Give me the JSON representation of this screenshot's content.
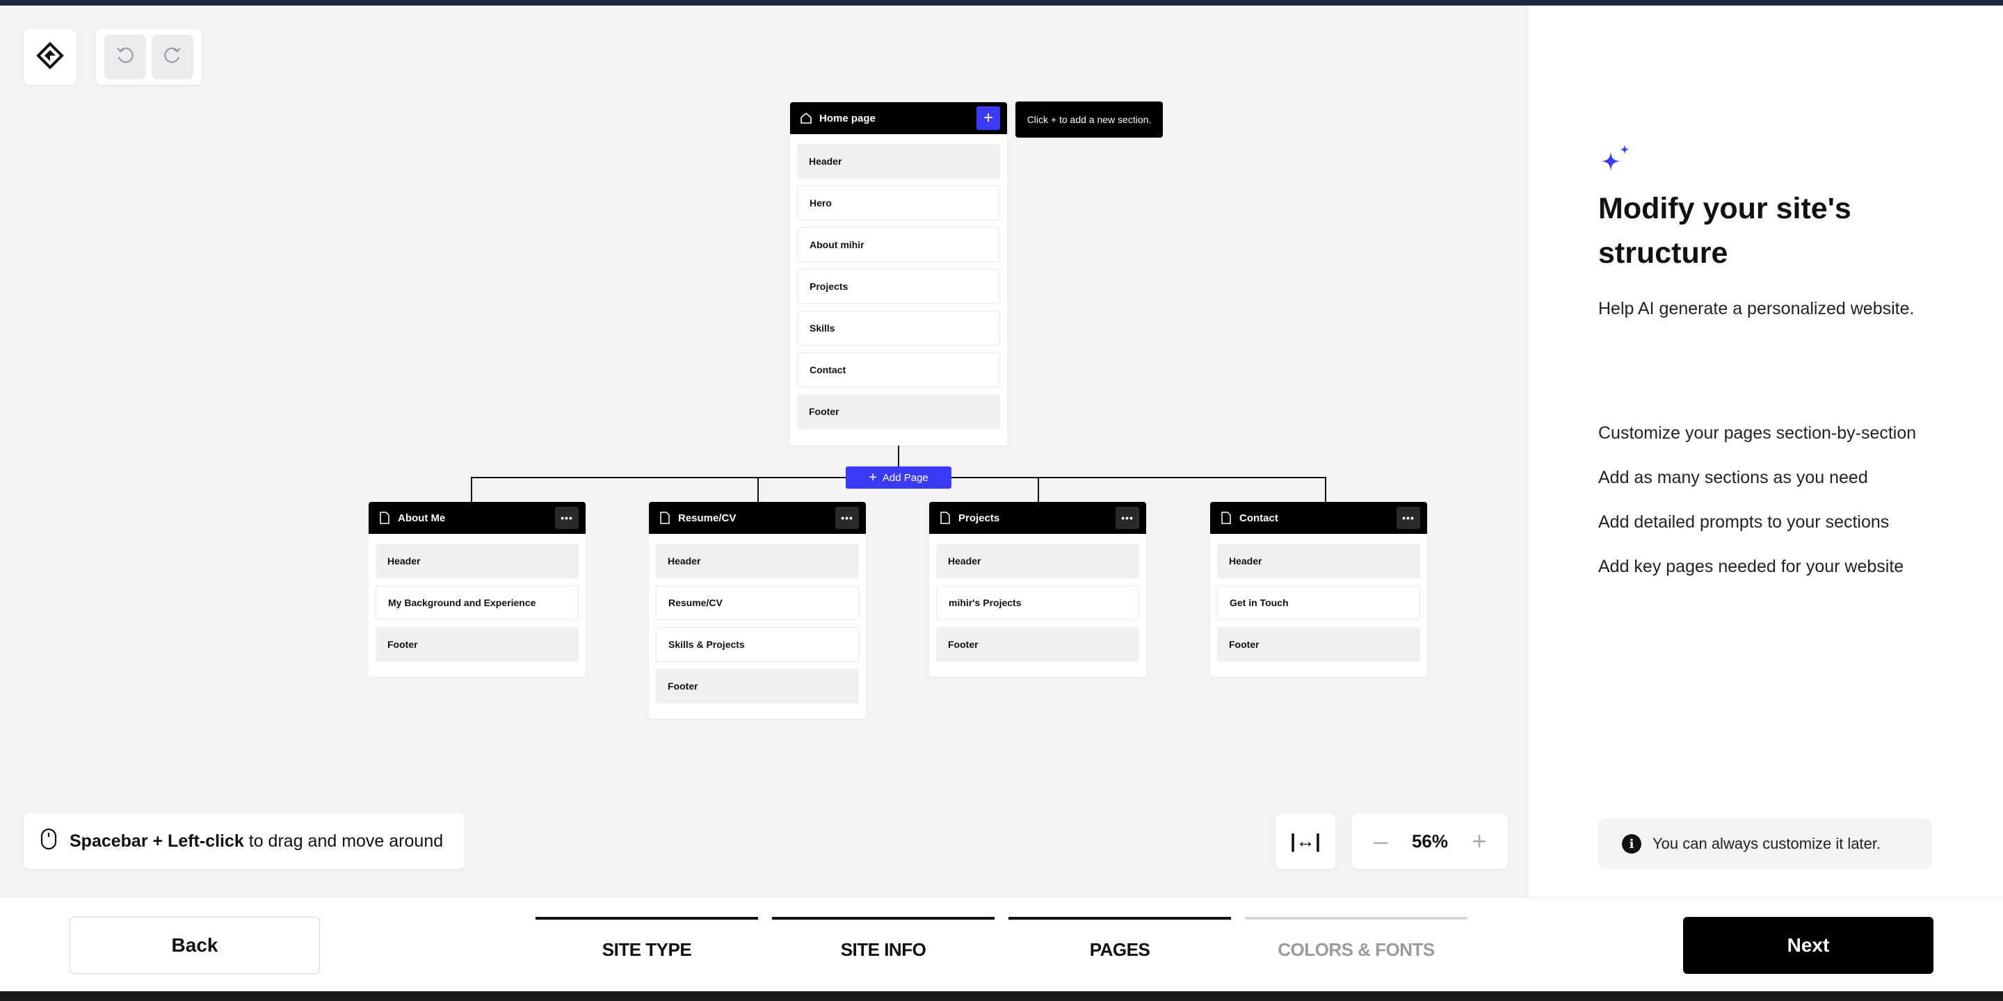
{
  "colors": {
    "accent": "#3b3bf5",
    "dark": "#000000",
    "canvas": "#f3f3f5"
  },
  "toolbar": {
    "logo_icon": "brand-logo-icon",
    "undo_icon": "undo-icon",
    "redo_icon": "redo-icon"
  },
  "tooltip": "Click + to add a new section.",
  "home": {
    "title": "Home page",
    "sections": [
      "Header",
      "Hero",
      "About mihir",
      "Projects",
      "Skills",
      "Contact",
      "Footer"
    ]
  },
  "add_page": {
    "label": "Add Page"
  },
  "pages": [
    {
      "title": "About Me",
      "sections": [
        "Header",
        "My Background and Experience",
        "Footer"
      ]
    },
    {
      "title": "Resume/CV",
      "sections": [
        "Header",
        "Resume/CV",
        "Skills & Projects",
        "Footer"
      ]
    },
    {
      "title": "Projects",
      "sections": [
        "Header",
        "mihir's Projects",
        "Footer"
      ]
    },
    {
      "title": "Contact",
      "sections": [
        "Header",
        "Get in Touch",
        "Footer"
      ]
    }
  ],
  "hint": {
    "bold": "Spacebar + Left-click",
    "rest": "to drag and move around"
  },
  "zoom": {
    "fit_label": "|↔|",
    "value": "56%",
    "minus": "–",
    "plus": "+"
  },
  "panel": {
    "title": "Modify your site's structure",
    "subtitle": "Help AI generate a personalized website.",
    "features": [
      "Customize your pages section-by-section",
      "Add as many sections as you need",
      "Add detailed prompts to your sections",
      "Add key pages needed for your website"
    ],
    "info": "You can always customize it later."
  },
  "footer": {
    "back": "Back",
    "next": "Next",
    "steps": [
      {
        "label": "SITE TYPE",
        "active": true
      },
      {
        "label": "SITE INFO",
        "active": true
      },
      {
        "label": "PAGES",
        "active": true
      },
      {
        "label": "COLORS & FONTS",
        "active": false
      }
    ]
  }
}
